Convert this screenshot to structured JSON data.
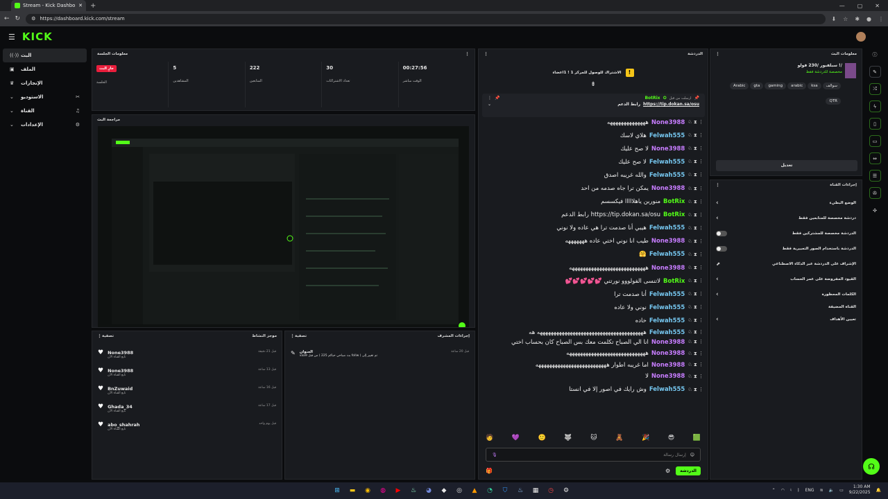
{
  "browser": {
    "tab_title": "Stream - Kick Dashboard",
    "url": "https://dashboard.kick.com/stream"
  },
  "header": {
    "logo": "KICK"
  },
  "sidebar": {
    "items": [
      {
        "label": "البث",
        "icon": "live-icon",
        "right": ""
      },
      {
        "label": "الملف",
        "icon": "profile-icon",
        "right": ""
      },
      {
        "label": "الإنجازات",
        "icon": "trophy-icon",
        "right": ""
      },
      {
        "label": "الاستوديو",
        "icon": "studio-icon",
        "right": "⌄"
      },
      {
        "label": "القناة",
        "icon": "channel-icon",
        "right": "⌄"
      },
      {
        "label": "الإعدادات",
        "icon": "settings-icon",
        "right": "⌄"
      }
    ]
  },
  "session": {
    "title": "معلومات الجلسة",
    "stats": [
      {
        "value": "جارٍ البث",
        "label": "الجلسة"
      },
      {
        "value": "5",
        "label": "المشاهدين"
      },
      {
        "value": "222",
        "label": "المتابعين"
      },
      {
        "value": "30",
        "label": "تعداد الاشتراكات"
      },
      {
        "value": "00:27:56",
        "label": "الوقت مباشر"
      }
    ]
  },
  "preview": {
    "title": "مراجعة البث"
  },
  "activity": {
    "title": "موجز النشاط",
    "filter": "تصفية",
    "items": [
      {
        "name": "None3988",
        "sub": "تابع القناة الآن",
        "time": "قبل 21 دقيقة"
      },
      {
        "name": "None3988",
        "sub": "تابع القناة الآن",
        "time": "قبل 13 ساعة"
      },
      {
        "name": "BnZuwaid",
        "sub": "تابع القناة الآن",
        "time": "قبل 16 ساعة"
      },
      {
        "name": "Ghada_34",
        "sub": "تابع القناة الآن",
        "time": "قبل 17 ساعة"
      },
      {
        "name": "abo_shahrah",
        "sub": "تابع القناة الآن",
        "time": "قبل يوم واحد"
      }
    ]
  },
  "modacts": {
    "title": "إجراءات المشرف",
    "filter": "تصفية",
    "item_title": "العنوان",
    "item_text": "vaa9 من قبل ( بث صباحي حياكم 225 follw ) تم تغيير إلى",
    "time": "قبل 20 ساعة"
  },
  "chat": {
    "title": "الدردشة",
    "goal": "الاشتراك للوصول للمركز 1 ! 1اعضاء",
    "pinned_by": "ارسلت من قبل",
    "pinned_user": "BotRix",
    "pinned_text": "رابط الدعم",
    "pinned_link": "https://tip.dokan.sa/osu",
    "messages": [
      {
        "user": "None3988",
        "color": "#c77dff",
        "text": "ههههههههههههههه"
      },
      {
        "user": "Felwah555",
        "color": "#76c7f0",
        "text": "هلاي لاسك"
      },
      {
        "user": "None3988",
        "color": "#c77dff",
        "text": "لا صح عليك"
      },
      {
        "user": "Felwah555",
        "color": "#76c7f0",
        "text": "لا صح عليك"
      },
      {
        "user": "Felwah555",
        "color": "#76c7f0",
        "text": "والله غريبه اصدق"
      },
      {
        "user": "None3988",
        "color": "#c77dff",
        "text": "يمكن ترا جاه صدمه من احد"
      },
      {
        "user": "BotRix",
        "color": "#53fc18",
        "text": "منوربن ياهلااااا فيكسسم"
      },
      {
        "user": "BotRix",
        "color": "#53fc18",
        "text": "https://tip.dokan.sa/osu رابط الدعم"
      },
      {
        "user": "Felwah555",
        "color": "#76c7f0",
        "text": "هيبي أنا صدمت ترا هي عاده ولا نوني"
      },
      {
        "user": "None3988",
        "color": "#c77dff",
        "text": "طيب انا نوني اختي عاده هههههههه"
      },
      {
        "user": "Felwah555",
        "color": "#76c7f0",
        "text": "🤗"
      },
      {
        "user": "None3988",
        "color": "#c77dff",
        "text": "ههههههههههههههههههههههههههههه"
      },
      {
        "user": "BotRix",
        "color": "#53fc18",
        "text": "لاتنسى الفولووو نورتني 💕💕💕💕💕"
      },
      {
        "user": "Felwah555",
        "color": "#76c7f0",
        "text": "أنا صدمت ترا"
      },
      {
        "user": "Felwah555",
        "color": "#76c7f0",
        "text": "نوني ولا عاده"
      },
      {
        "user": "Felwah555",
        "color": "#76c7f0",
        "text": "خاده"
      },
      {
        "user": "Felwah555",
        "color": "#76c7f0",
        "text": "هههههههههههههههههههههههههههههههههههههههه هه"
      },
      {
        "user": "None3988",
        "color": "#c77dff",
        "text": "انا الي الصباح تكلمت معك بس الصباح كان بحساب اختي"
      },
      {
        "user": "None3988",
        "color": "#c77dff",
        "text": "هههههههههههههههههههههههههههههه"
      },
      {
        "user": "None3988",
        "color": "#c77dff",
        "text": "اما غريبه اطوار ههههههههههههههههههههههههههه"
      },
      {
        "user": "None3988",
        "color": "#c77dff",
        "text": "لا"
      },
      {
        "user": "Felwah555",
        "color": "#76c7f0",
        "text": "وش رايك في اصور إلا في انستا"
      }
    ],
    "placeholder": "إرسال رسالة",
    "send": "الدردشة"
  },
  "sinfo": {
    "title": "معلومات البث",
    "stream_title": "سبلفبور /230 فولو !/",
    "category": "مخصصة للدردشة فقط",
    "tags": [
      "Arabic",
      "gta",
      "gaming",
      "arabic",
      "ksa",
      "سوالف",
      "QTR"
    ],
    "edit": "تعديل"
  },
  "channel_actions": {
    "title": "إجراءات القناة",
    "rows": [
      {
        "label": "الوضع البطيء",
        "ctl": "chev"
      },
      {
        "label": "دردشة مخصصة للمتابعين فقط",
        "ctl": "chev"
      },
      {
        "label": "الدردشة مخصصة للمشتركين فقط",
        "ctl": "toggle"
      },
      {
        "label": "الدردشة باستخدام الصور التعبيرية فقط",
        "ctl": "toggle"
      },
      {
        "label": "الإشراف على الدردشة عبر الذكاء الاصطناعي",
        "ctl": "ext"
      },
      {
        "label": "القيود المفروضة على عمر الحساب",
        "ctl": "chev"
      },
      {
        "label": "الكلمات المحظورة",
        "ctl": "chev"
      }
    ],
    "section": "القناة المضيفة",
    "host_row": "تعيين الأهداف"
  },
  "taskbar": {
    "lang": "ENG",
    "time": "1:30 AM",
    "date": "9/22/2025"
  }
}
